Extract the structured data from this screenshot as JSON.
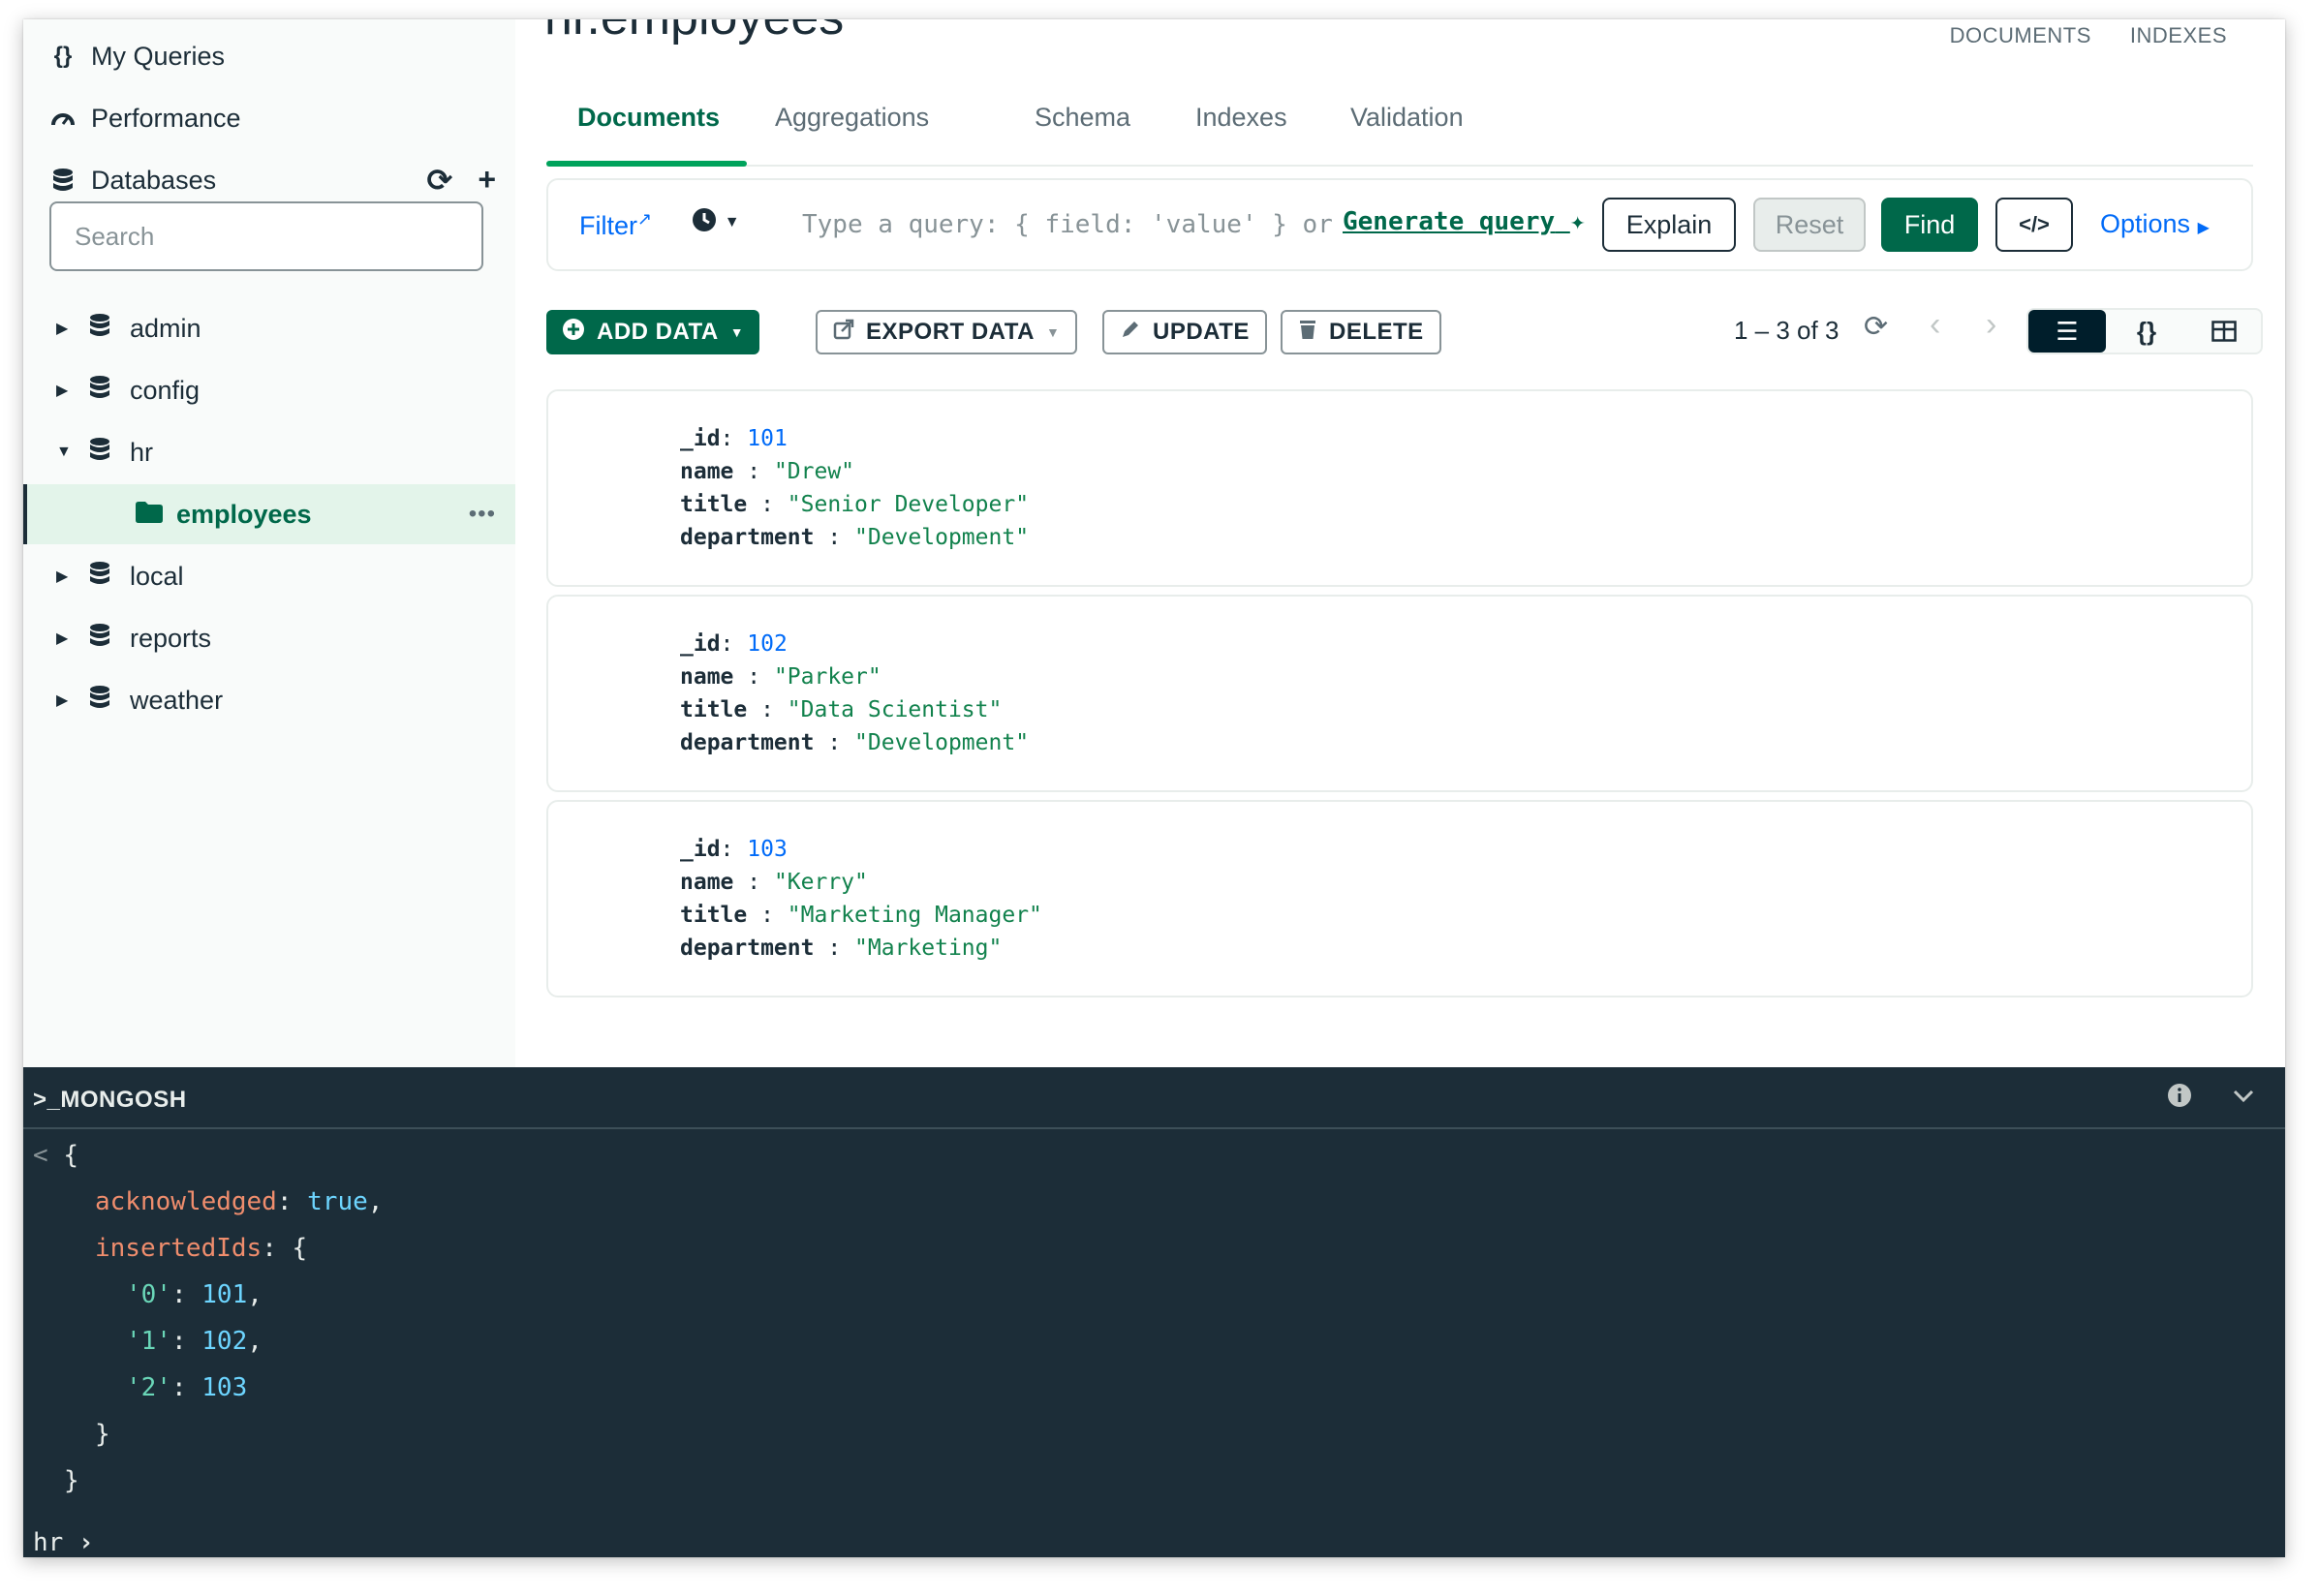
{
  "sidebar": {
    "nav": [
      {
        "label": "My Queries",
        "icon": "curly-braces-icon"
      },
      {
        "label": "Performance",
        "icon": "gauge-icon"
      }
    ],
    "databases_label": "Databases",
    "search_placeholder": "Search",
    "databases": [
      {
        "name": "admin",
        "expanded": false
      },
      {
        "name": "config",
        "expanded": false
      },
      {
        "name": "hr",
        "expanded": true
      },
      {
        "name": "local",
        "expanded": false
      },
      {
        "name": "reports",
        "expanded": false
      },
      {
        "name": "weather",
        "expanded": false
      }
    ],
    "active_collection": "employees"
  },
  "main": {
    "collection_title": "hr.employees",
    "top_links": [
      "DOCUMENTS",
      "INDEXES"
    ],
    "tabs": [
      "Documents",
      "Aggregations",
      "Schema",
      "Indexes",
      "Validation"
    ],
    "selected_tab": "Documents",
    "query_bar": {
      "filter_label": "Filter",
      "placeholder": "Type a query: { field: 'value' } or",
      "generate_label": "Generate query",
      "explain": "Explain",
      "reset": "Reset",
      "find": "Find",
      "options": "Options"
    },
    "toolbar": {
      "add_data": "ADD DATA",
      "export_data": "EXPORT DATA",
      "update": "UPDATE",
      "delete": "DELETE",
      "pagination": "1 – 3 of 3"
    },
    "documents": [
      {
        "_id": "101",
        "name": "\"Drew\"",
        "title": "\"Senior Developer\"",
        "department": "\"Development\""
      },
      {
        "_id": "102",
        "name": "\"Parker\"",
        "title": "\"Data Scientist\"",
        "department": "\"Development\""
      },
      {
        "_id": "103",
        "name": "\"Kerry\"",
        "title": "\"Marketing Manager\"",
        "department": "\"Marketing\""
      }
    ],
    "field_keys": {
      "id": "_id",
      "name": "name",
      "title": "title",
      "department": "department"
    }
  },
  "shell": {
    "title": ">_MONGOSH",
    "output": {
      "open": "{",
      "acknowledged_key": "acknowledged",
      "acknowledged_val": "true",
      "insertedIds_key": "insertedIds",
      "ids": [
        {
          "key": "'0'",
          "val": "101"
        },
        {
          "key": "'1'",
          "val": "102"
        },
        {
          "key": "'2'",
          "val": "103"
        }
      ],
      "inner_close": "}",
      "close": "}"
    },
    "prompt": "hr"
  },
  "colors": {
    "brand_green": "#00684a",
    "accent_green": "#00a35c",
    "link_blue": "#016bf8",
    "shell_bg": "#1c2d38"
  }
}
